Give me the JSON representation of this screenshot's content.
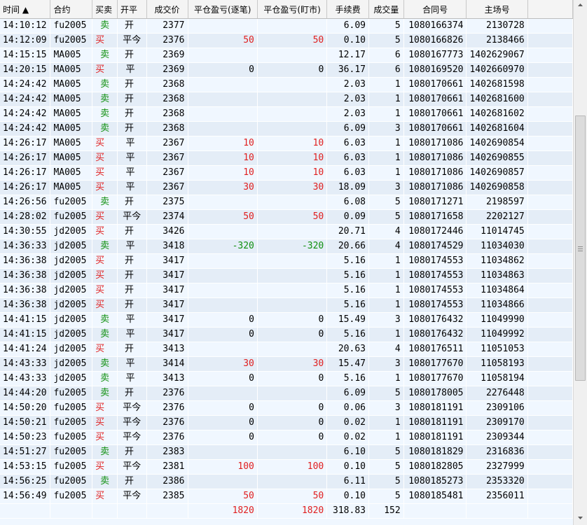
{
  "columns": [
    {
      "key": "time",
      "label": "时间",
      "sort_icon": "sort-asc-icon"
    },
    {
      "key": "contract",
      "label": "合约"
    },
    {
      "key": "side",
      "label": "买卖"
    },
    {
      "key": "openclose",
      "label": "开平"
    },
    {
      "key": "price",
      "label": "成交价"
    },
    {
      "key": "pnl_trade",
      "label": "平仓盈亏(逐笔)"
    },
    {
      "key": "pnl_mark",
      "label": "平仓盈亏(盯市)"
    },
    {
      "key": "fee",
      "label": "手续费"
    },
    {
      "key": "qty",
      "label": "成交量"
    },
    {
      "key": "contract_no",
      "label": "合同号"
    },
    {
      "key": "venue_no",
      "label": "主场号"
    }
  ],
  "rows": [
    [
      "14:10:12",
      "fu2005",
      "卖",
      "开",
      "2377",
      "",
      "",
      "6.09",
      "5",
      "1080166374",
      "2130728"
    ],
    [
      "14:12:09",
      "fu2005",
      "买",
      "平今",
      "2376",
      "50",
      "50",
      "0.10",
      "5",
      "1080166826",
      "2138466"
    ],
    [
      "14:15:15",
      "MA005",
      "卖",
      "开",
      "2369",
      "",
      "",
      "12.17",
      "6",
      "1080167773",
      "1402629067"
    ],
    [
      "14:20:15",
      "MA005",
      "买",
      "平",
      "2369",
      "0",
      "0",
      "36.17",
      "6",
      "1080169520",
      "1402660970"
    ],
    [
      "14:24:42",
      "MA005",
      "卖",
      "开",
      "2368",
      "",
      "",
      "2.03",
      "1",
      "1080170661",
      "1402681598"
    ],
    [
      "14:24:42",
      "MA005",
      "卖",
      "开",
      "2368",
      "",
      "",
      "2.03",
      "1",
      "1080170661",
      "1402681600"
    ],
    [
      "14:24:42",
      "MA005",
      "卖",
      "开",
      "2368",
      "",
      "",
      "2.03",
      "1",
      "1080170661",
      "1402681602"
    ],
    [
      "14:24:42",
      "MA005",
      "卖",
      "开",
      "2368",
      "",
      "",
      "6.09",
      "3",
      "1080170661",
      "1402681604"
    ],
    [
      "14:26:17",
      "MA005",
      "买",
      "平",
      "2367",
      "10",
      "10",
      "6.03",
      "1",
      "1080171086",
      "1402690854"
    ],
    [
      "14:26:17",
      "MA005",
      "买",
      "平",
      "2367",
      "10",
      "10",
      "6.03",
      "1",
      "1080171086",
      "1402690855"
    ],
    [
      "14:26:17",
      "MA005",
      "买",
      "平",
      "2367",
      "10",
      "10",
      "6.03",
      "1",
      "1080171086",
      "1402690857"
    ],
    [
      "14:26:17",
      "MA005",
      "买",
      "平",
      "2367",
      "30",
      "30",
      "18.09",
      "3",
      "1080171086",
      "1402690858"
    ],
    [
      "14:26:56",
      "fu2005",
      "卖",
      "开",
      "2375",
      "",
      "",
      "6.08",
      "5",
      "1080171271",
      "2198597"
    ],
    [
      "14:28:02",
      "fu2005",
      "买",
      "平今",
      "2374",
      "50",
      "50",
      "0.09",
      "5",
      "1080171658",
      "2202127"
    ],
    [
      "14:30:55",
      "jd2005",
      "买",
      "开",
      "3426",
      "",
      "",
      "20.71",
      "4",
      "1080172446",
      "11014745"
    ],
    [
      "14:36:33",
      "jd2005",
      "卖",
      "平",
      "3418",
      "-320",
      "-320",
      "20.66",
      "4",
      "1080174529",
      "11034030"
    ],
    [
      "14:36:38",
      "jd2005",
      "买",
      "开",
      "3417",
      "",
      "",
      "5.16",
      "1",
      "1080174553",
      "11034862"
    ],
    [
      "14:36:38",
      "jd2005",
      "买",
      "开",
      "3417",
      "",
      "",
      "5.16",
      "1",
      "1080174553",
      "11034863"
    ],
    [
      "14:36:38",
      "jd2005",
      "买",
      "开",
      "3417",
      "",
      "",
      "5.16",
      "1",
      "1080174553",
      "11034864"
    ],
    [
      "14:36:38",
      "jd2005",
      "买",
      "开",
      "3417",
      "",
      "",
      "5.16",
      "1",
      "1080174553",
      "11034866"
    ],
    [
      "14:41:15",
      "jd2005",
      "卖",
      "平",
      "3417",
      "0",
      "0",
      "15.49",
      "3",
      "1080176432",
      "11049990"
    ],
    [
      "14:41:15",
      "jd2005",
      "卖",
      "平",
      "3417",
      "0",
      "0",
      "5.16",
      "1",
      "1080176432",
      "11049992"
    ],
    [
      "14:41:24",
      "jd2005",
      "买",
      "开",
      "3413",
      "",
      "",
      "20.63",
      "4",
      "1080176511",
      "11051053"
    ],
    [
      "14:43:33",
      "jd2005",
      "卖",
      "平",
      "3414",
      "30",
      "30",
      "15.47",
      "3",
      "1080177670",
      "11058193"
    ],
    [
      "14:43:33",
      "jd2005",
      "卖",
      "平",
      "3413",
      "0",
      "0",
      "5.16",
      "1",
      "1080177670",
      "11058194"
    ],
    [
      "14:44:20",
      "fu2005",
      "卖",
      "开",
      "2376",
      "",
      "",
      "6.09",
      "5",
      "1080178005",
      "2276448"
    ],
    [
      "14:50:20",
      "fu2005",
      "买",
      "平今",
      "2376",
      "0",
      "0",
      "0.06",
      "3",
      "1080181191",
      "2309106"
    ],
    [
      "14:50:21",
      "fu2005",
      "买",
      "平今",
      "2376",
      "0",
      "0",
      "0.02",
      "1",
      "1080181191",
      "2309170"
    ],
    [
      "14:50:23",
      "fu2005",
      "买",
      "平今",
      "2376",
      "0",
      "0",
      "0.02",
      "1",
      "1080181191",
      "2309344"
    ],
    [
      "14:51:27",
      "fu2005",
      "卖",
      "开",
      "2383",
      "",
      "",
      "6.10",
      "5",
      "1080181829",
      "2316836"
    ],
    [
      "14:53:15",
      "fu2005",
      "买",
      "平今",
      "2381",
      "100",
      "100",
      "0.10",
      "5",
      "1080182805",
      "2327999"
    ],
    [
      "14:56:25",
      "fu2005",
      "卖",
      "开",
      "2386",
      "",
      "",
      "6.11",
      "5",
      "1080185273",
      "2353320"
    ],
    [
      "14:56:49",
      "fu2005",
      "买",
      "平今",
      "2385",
      "50",
      "50",
      "0.10",
      "5",
      "1080185481",
      "2356011"
    ]
  ],
  "totals": {
    "pnl_trade": "1820",
    "pnl_mark": "1820",
    "fee": "318.83",
    "qty": "152"
  },
  "colors": {
    "buy": "#e02020",
    "sell": "#109010",
    "row_odd": "#f0f7ff",
    "row_even": "#e4edf7",
    "header": "#f4f4f4"
  },
  "scrollbar": {
    "position_fraction": 0.44,
    "visible_fraction": 0.53,
    "icons": [
      "scroll-up-icon",
      "scroll-down-icon",
      "grip-icon"
    ]
  }
}
